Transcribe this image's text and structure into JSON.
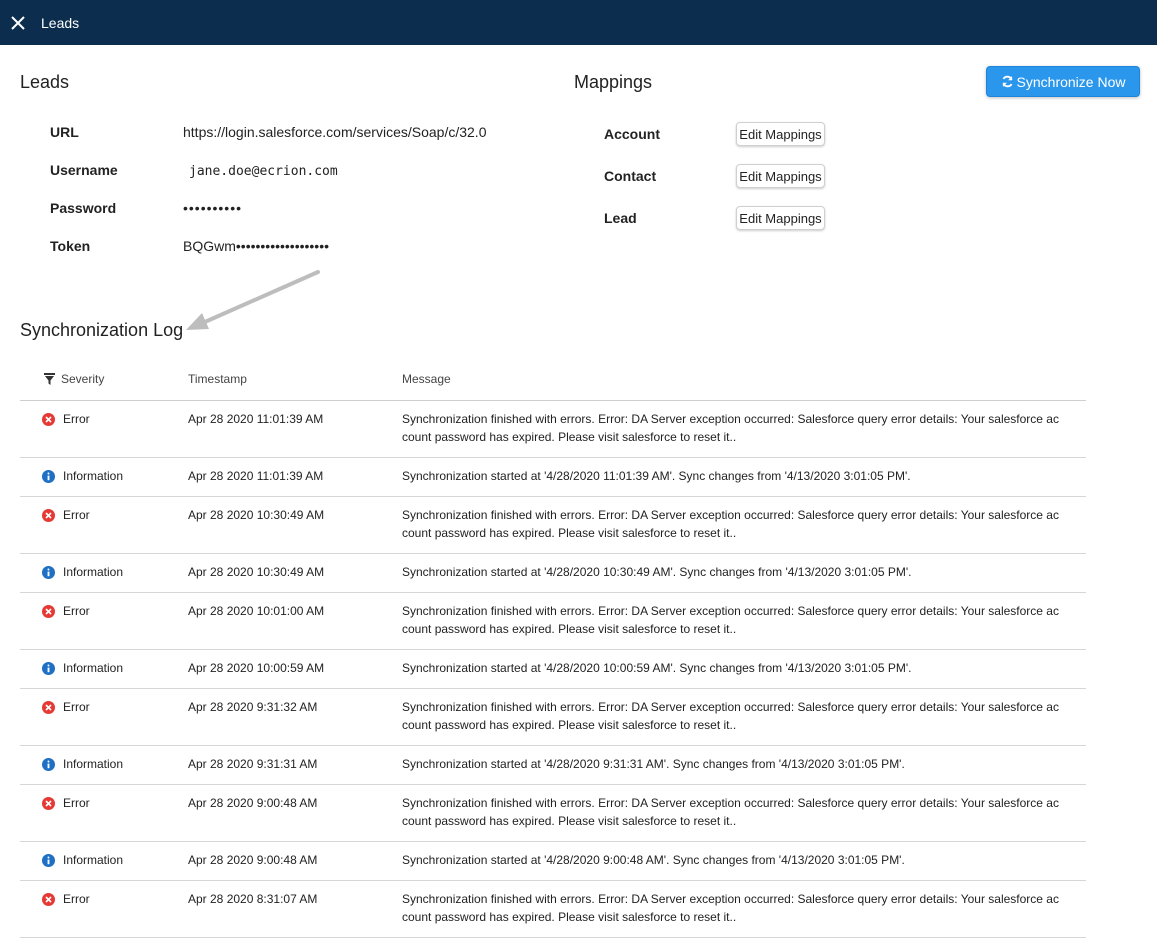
{
  "header": {
    "title": "Leads"
  },
  "connection": {
    "title": "Leads",
    "fields": [
      {
        "label": "URL",
        "value": "https://login.salesforce.com/services/Soap/c/32.0"
      },
      {
        "label": "Username",
        "value": "jane.doe@ecrion.com"
      },
      {
        "label": "Password",
        "value": "••••••••••"
      },
      {
        "label": "Token",
        "value": "BQGwm•••••••••••••••••••"
      }
    ]
  },
  "mappings": {
    "title": "Mappings",
    "items": [
      {
        "label": "Account",
        "button": "Edit Mappings"
      },
      {
        "label": "Contact",
        "button": "Edit Mappings"
      },
      {
        "label": "Lead",
        "button": "Edit Mappings"
      }
    ]
  },
  "sync_button": "Synchronize Now",
  "log": {
    "title": "Synchronization Log",
    "columns": {
      "severity": "Severity",
      "timestamp": "Timestamp",
      "message": "Message"
    },
    "rows": [
      {
        "severity": "Error",
        "timestamp": "Apr 28 2020 11:01:39 AM",
        "message": "Synchronization finished with errors. Error: DA Server exception occurred: Salesforce query error details: Your salesforce account password has expired. Please visit salesforce to reset it.."
      },
      {
        "severity": "Information",
        "timestamp": "Apr 28 2020 11:01:39 AM",
        "message": "Synchronization started at '4/28/2020 11:01:39 AM'. Sync changes from '4/13/2020 3:01:05 PM'."
      },
      {
        "severity": "Error",
        "timestamp": "Apr 28 2020 10:30:49 AM",
        "message": "Synchronization finished with errors. Error: DA Server exception occurred: Salesforce query error details: Your salesforce account password has expired. Please visit salesforce to reset it.."
      },
      {
        "severity": "Information",
        "timestamp": "Apr 28 2020 10:30:49 AM",
        "message": "Synchronization started at '4/28/2020 10:30:49 AM'. Sync changes from '4/13/2020 3:01:05 PM'."
      },
      {
        "severity": "Error",
        "timestamp": "Apr 28 2020 10:01:00 AM",
        "message": "Synchronization finished with errors. Error: DA Server exception occurred: Salesforce query error details: Your salesforce account password has expired. Please visit salesforce to reset it.."
      },
      {
        "severity": "Information",
        "timestamp": "Apr 28 2020 10:00:59 AM",
        "message": "Synchronization started at '4/28/2020 10:00:59 AM'. Sync changes from '4/13/2020 3:01:05 PM'."
      },
      {
        "severity": "Error",
        "timestamp": "Apr 28 2020 9:31:32 AM",
        "message": "Synchronization finished with errors. Error: DA Server exception occurred: Salesforce query error details: Your salesforce account password has expired. Please visit salesforce to reset it.."
      },
      {
        "severity": "Information",
        "timestamp": "Apr 28 2020 9:31:31 AM",
        "message": "Synchronization started at '4/28/2020 9:31:31 AM'. Sync changes from '4/13/2020 3:01:05 PM'."
      },
      {
        "severity": "Error",
        "timestamp": "Apr 28 2020 9:00:48 AM",
        "message": "Synchronization finished with errors. Error: DA Server exception occurred: Salesforce query error details: Your salesforce account password has expired. Please visit salesforce to reset it.."
      },
      {
        "severity": "Information",
        "timestamp": "Apr 28 2020 9:00:48 AM",
        "message": "Synchronization started at '4/28/2020 9:00:48 AM'. Sync changes from '4/13/2020 3:01:05 PM'."
      },
      {
        "severity": "Error",
        "timestamp": "Apr 28 2020 8:31:07 AM",
        "message": "Synchronization finished with errors. Error: DA Server exception occurred: Salesforce query error details: Your salesforce account password has expired. Please visit salesforce to reset it.."
      }
    ]
  },
  "colors": {
    "header_bg": "#0c2d4e",
    "accent": "#2b97ec",
    "error": "#e53935",
    "info": "#1f6fc5"
  }
}
